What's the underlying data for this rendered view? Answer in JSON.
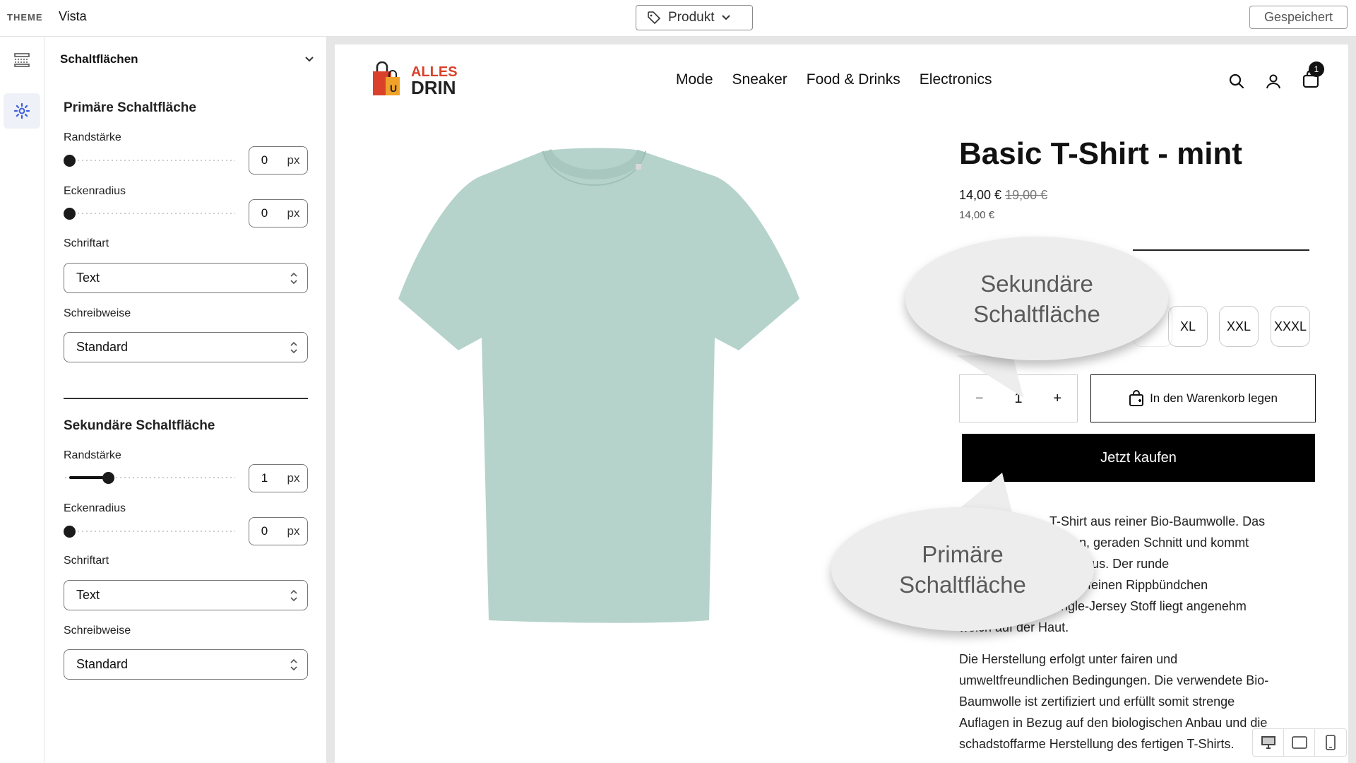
{
  "topbar": {
    "theme_label": "THEME",
    "theme_name": "Vista",
    "page_select": "Produkt",
    "saved_label": "Gespeichert"
  },
  "panel": {
    "header": "Schaltflächen",
    "primary": {
      "title": "Primäre Schaltfläche",
      "border_label": "Randstärke",
      "border_value": "0",
      "radius_label": "Eckenradius",
      "radius_value": "0",
      "font_label": "Schriftart",
      "font_value": "Text",
      "case_label": "Schreibweise",
      "case_value": "Standard"
    },
    "secondary": {
      "title": "Sekundäre Schaltfläche",
      "border_label": "Randstärke",
      "border_value": "1",
      "radius_label": "Eckenradius",
      "radius_value": "0",
      "font_label": "Schriftart",
      "font_value": "Text",
      "case_label": "Schreibweise",
      "case_value": "Standard"
    },
    "unit": "px"
  },
  "store": {
    "logo_top": "ALLES",
    "logo_bottom": "DRIN",
    "nav": [
      "Mode",
      "Sneaker",
      "Food & Drinks",
      "Electronics"
    ],
    "cart_count": "1"
  },
  "product": {
    "title": "Basic T-Shirt - mint",
    "price": "14,00 €",
    "old_price": "19,00 €",
    "unit_price": "14,00 €",
    "sizes": [
      "XL",
      "XXL",
      "XXXL"
    ],
    "quantity": "1",
    "add_to_cart": "In den Warenkorb legen",
    "buy_now": "Jetzt kaufen",
    "desc1": [
      "T-Shirt aus reiner Bio-Baumwolle. Das",
      "ischen, geraden Schnitt und kommt",
      "nähte aus. Der runde",
      "einem feinen Rippbündchen",
      "Single-Jersey Stoff liegt angenehm",
      "weich auf der Haut."
    ],
    "desc2": [
      "Die Herstellung erfolgt unter fairen und",
      "umweltfreundlichen Bedingungen. Die verwendete Bio-",
      "Baumwolle ist zertifiziert und erfüllt somit strenge",
      "Auflagen in Bezug auf den biologischen Anbau und die",
      "schadstoffarme Herstellung des fertigen T-Shirts."
    ]
  },
  "callouts": {
    "secondary_line1": "Sekundäre",
    "secondary_line2": "Schaltfläche",
    "primary_line1": "Primäre",
    "primary_line2": "Schaltfläche"
  },
  "colors": {
    "tshirt": "#b5d3cb",
    "accent": "#3b5bdb",
    "logo_red": "#d9412b",
    "logo_orange": "#f0a129"
  }
}
